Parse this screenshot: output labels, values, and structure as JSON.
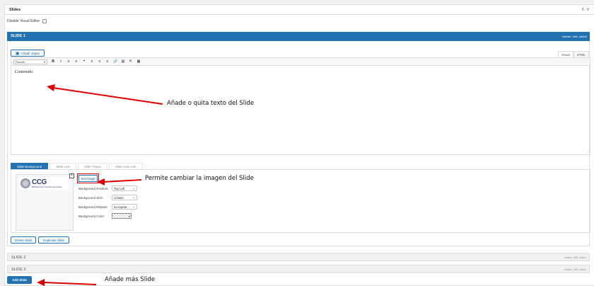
{
  "panel": {
    "title": "Slides",
    "toggles": "∧ ∨"
  },
  "disable_visual_editor": "Disable Visual Editor:",
  "slides": [
    {
      "label": "SLIDE 1",
      "id": "#slider_345_slide0"
    },
    {
      "label": "SLIDE 2",
      "id": "#slider_345_slide1"
    },
    {
      "label": "SLIDE 3",
      "id": "#slider_345_slide2"
    }
  ],
  "editor": {
    "add_media": "Añadir objeto",
    "tab_visual": "Visual",
    "tab_html": "HTML",
    "paragraph": "Párrafo",
    "content": "Contenido"
  },
  "bg_tabs": [
    "Slide Background",
    "Slide Link",
    "Slide Popus",
    "Slide Solo Link"
  ],
  "thumb": {
    "logo_letters": "CCG",
    "logo_caption": "Biblioteca de la Ciencias Genómicas"
  },
  "set_image": "Set image",
  "fields": {
    "position": {
      "label": "Background Position:",
      "value": "Top Left"
    },
    "size": {
      "label": "Background Size:",
      "value": "contain"
    },
    "repeat": {
      "label": "Background Repeat:",
      "value": "no-repeat"
    },
    "color": {
      "label": "Background Color:"
    }
  },
  "buttons": {
    "delete": "Delete Slide",
    "duplicate": "Duplicate Slide",
    "add": "Add Slide"
  },
  "annotations": {
    "text": "Añade o quita texto del Slide",
    "image": "Permite cambiar la imagen del Slide",
    "more": "Añade más Slide"
  },
  "colors": {
    "accent": "#2271b1",
    "annotation_arrow": "#e00000"
  }
}
